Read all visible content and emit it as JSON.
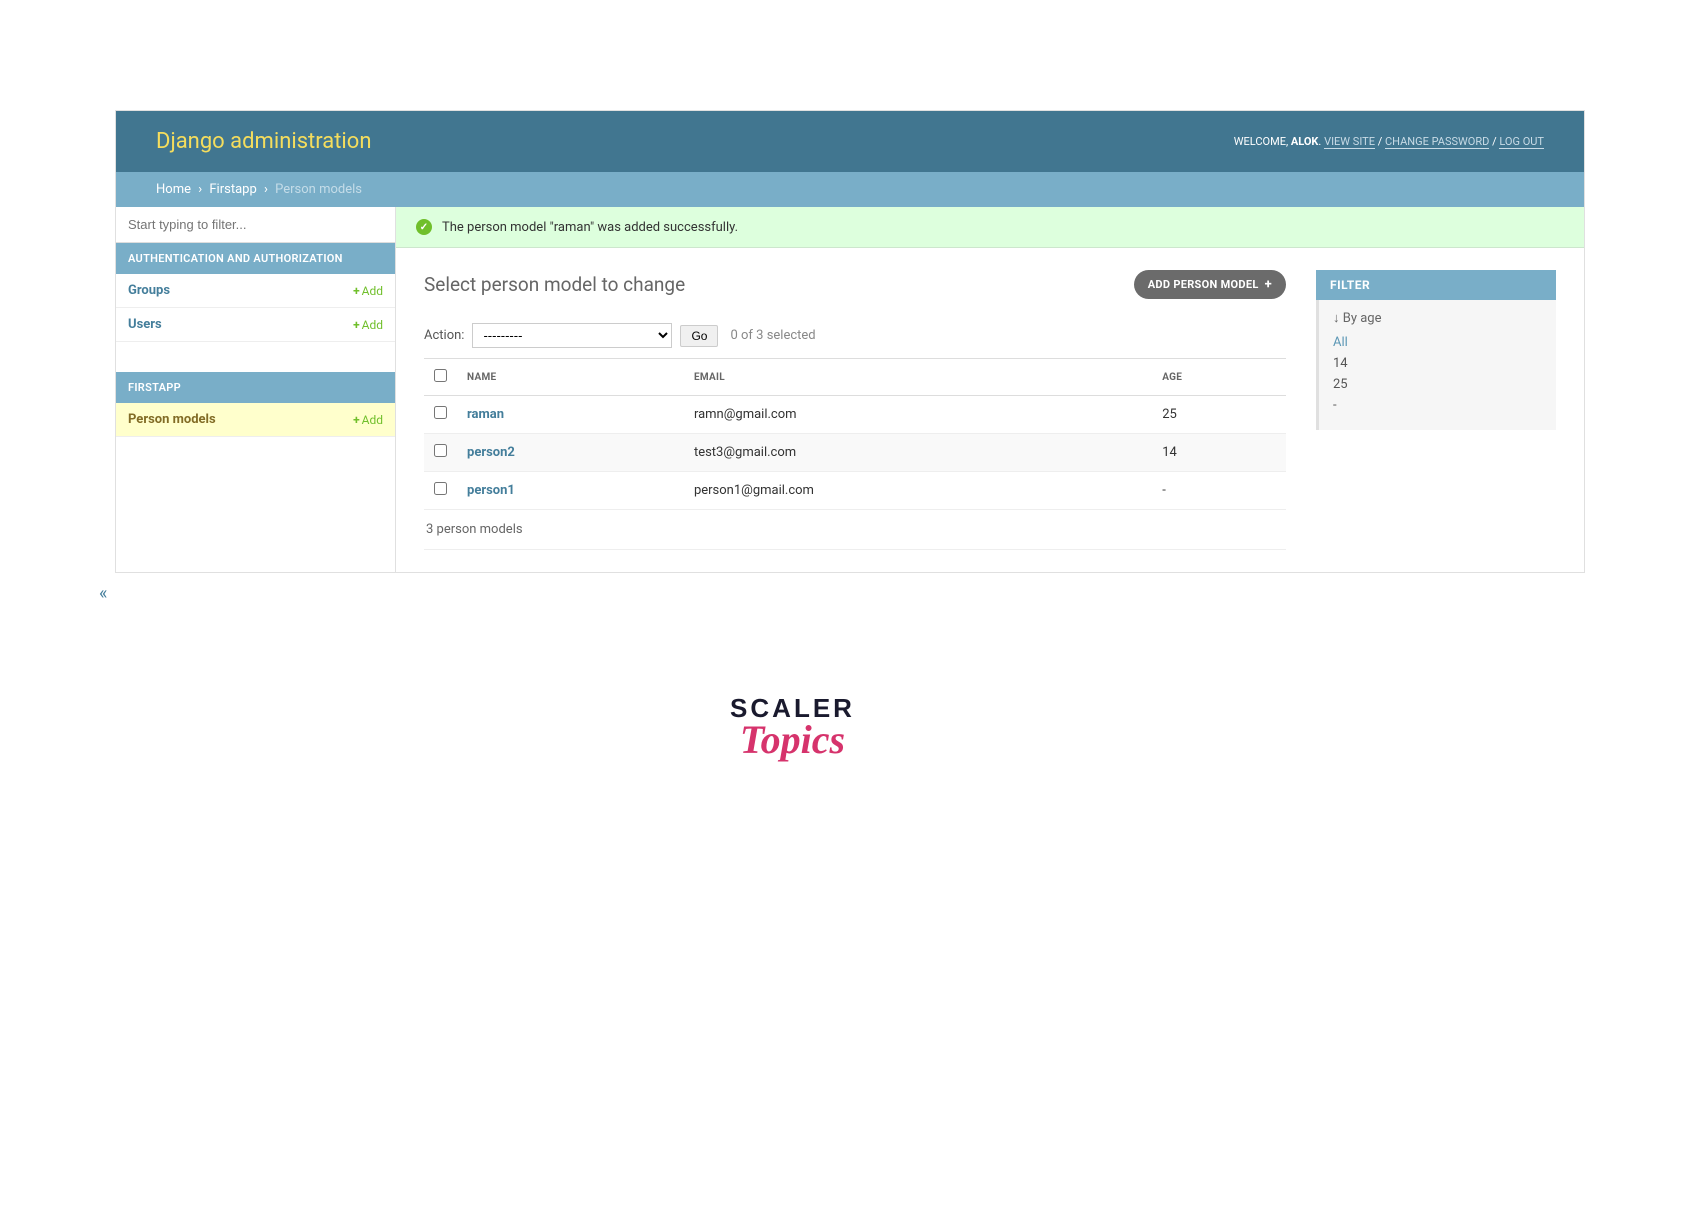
{
  "branding": {
    "title": "Django administration",
    "welcome": "WELCOME, ",
    "username": "ALOK",
    "view_site": "VIEW SITE",
    "change_password": "CHANGE PASSWORD",
    "log_out": "LOG OUT"
  },
  "breadcrumbs": {
    "home": "Home",
    "app": "Firstapp",
    "current": "Person models"
  },
  "sidebar": {
    "filter_placeholder": "Start typing to filter...",
    "sections": [
      {
        "header": "AUTHENTICATION AND AUTHORIZATION",
        "items": [
          {
            "label": "Groups",
            "add": "Add"
          },
          {
            "label": "Users",
            "add": "Add"
          }
        ]
      },
      {
        "header": "FIRSTAPP",
        "items": [
          {
            "label": "Person models",
            "add": "Add",
            "active": true
          }
        ]
      }
    ]
  },
  "message": {
    "text": "The person model \"raman\" was added successfully."
  },
  "page": {
    "title": "Select person model to change",
    "add_button": "ADD PERSON MODEL"
  },
  "actions": {
    "label": "Action:",
    "placeholder": "---------",
    "go": "Go",
    "counter": "0 of 3 selected"
  },
  "table": {
    "columns": {
      "name": "NAME",
      "email": "EMAIL",
      "age": "AGE"
    },
    "rows": [
      {
        "name": "raman",
        "email": "ramn@gmail.com",
        "age": "25"
      },
      {
        "name": "person2",
        "email": "test3@gmail.com",
        "age": "14"
      },
      {
        "name": "person1",
        "email": "person1@gmail.com",
        "age": "-"
      }
    ]
  },
  "paginator": "3 person models",
  "filter": {
    "header": "FILTER",
    "title": "↓ By age",
    "options": [
      {
        "label": "All",
        "selected": true
      },
      {
        "label": "14"
      },
      {
        "label": "25"
      },
      {
        "label": "-"
      }
    ]
  },
  "collapse_glyph": "«",
  "logo": {
    "main": "SCALER",
    "sub": "Topics"
  }
}
